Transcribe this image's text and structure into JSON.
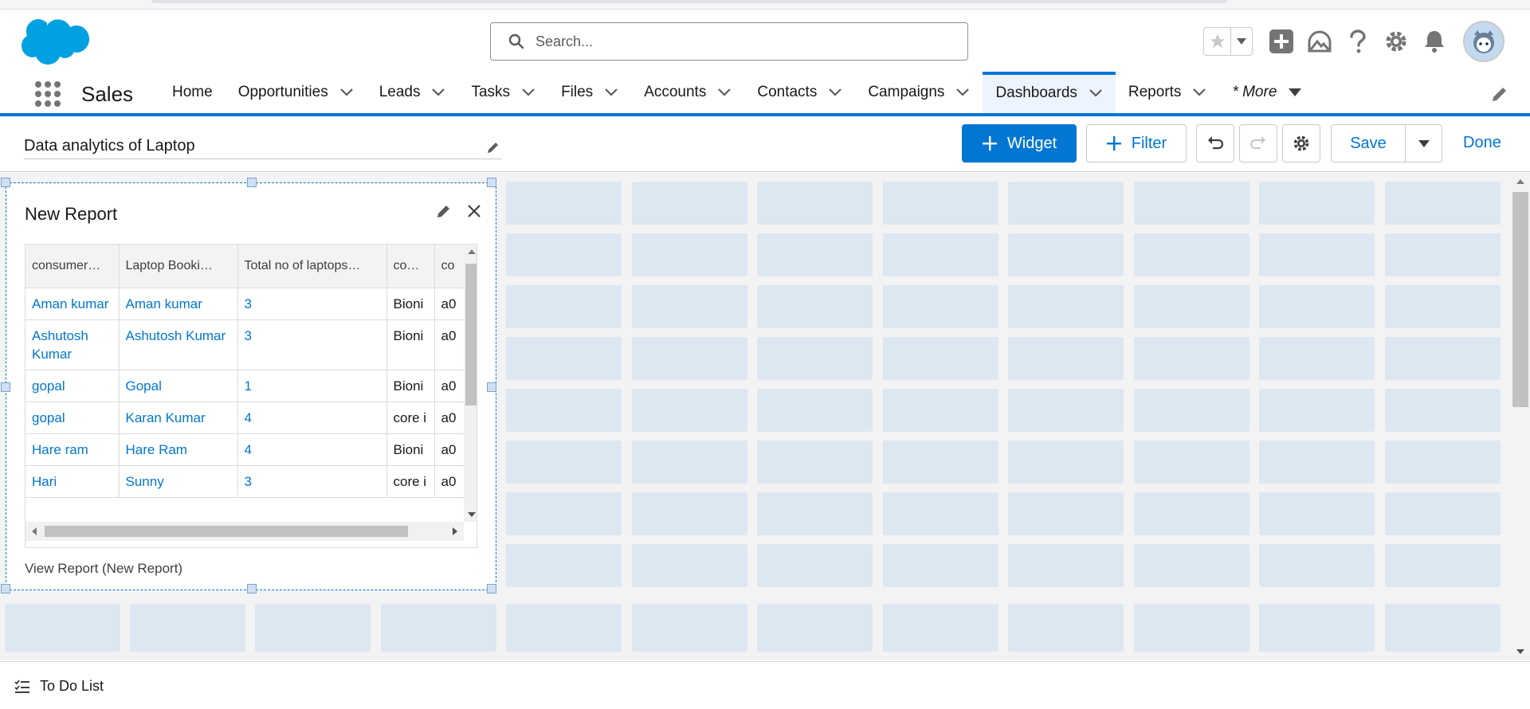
{
  "app": {
    "name": "Sales",
    "search_placeholder": "Search..."
  },
  "nav": {
    "items": [
      {
        "label": "Home",
        "has_menu": false
      },
      {
        "label": "Opportunities",
        "has_menu": true
      },
      {
        "label": "Leads",
        "has_menu": true
      },
      {
        "label": "Tasks",
        "has_menu": true
      },
      {
        "label": "Files",
        "has_menu": true
      },
      {
        "label": "Accounts",
        "has_menu": true
      },
      {
        "label": "Contacts",
        "has_menu": true
      },
      {
        "label": "Campaigns",
        "has_menu": true
      },
      {
        "label": "Dashboards",
        "has_menu": true,
        "active": true
      },
      {
        "label": "Reports",
        "has_menu": true
      },
      {
        "label": "* More",
        "has_menu": true
      }
    ]
  },
  "toolbar": {
    "dashboard_title": "Data analytics of Laptop",
    "widget_label": "Widget",
    "filter_label": "Filter",
    "save_label": "Save",
    "done_label": "Done"
  },
  "widget": {
    "title": "New Report",
    "view_report_link": "View Report (New Report)",
    "columns": [
      "consumer…",
      "Laptop Booki…",
      "Total no of laptops…",
      "co…",
      "co"
    ],
    "rows": [
      [
        "Aman kumar",
        "Aman kumar",
        "3",
        "Bioni",
        "a0"
      ],
      [
        "Ashutosh Kumar",
        "Ashutosh Kumar",
        "3",
        "Bioni",
        "a0"
      ],
      [
        "gopal",
        "Gopal",
        "1",
        "Bioni",
        "a0"
      ],
      [
        "gopal",
        "Karan Kumar",
        "4",
        "core i",
        "a0"
      ],
      [
        "Hare ram",
        "Hare Ram",
        "4",
        "Bioni",
        "a0"
      ],
      [
        "Hari",
        "Sunny",
        "3",
        "core i",
        "a0"
      ]
    ]
  },
  "utility": {
    "todo_label": "To Do List"
  },
  "colors": {
    "brand": "#0176d3",
    "grid_cell": "#dde7f2",
    "canvas_bg": "#f3f3f3"
  }
}
